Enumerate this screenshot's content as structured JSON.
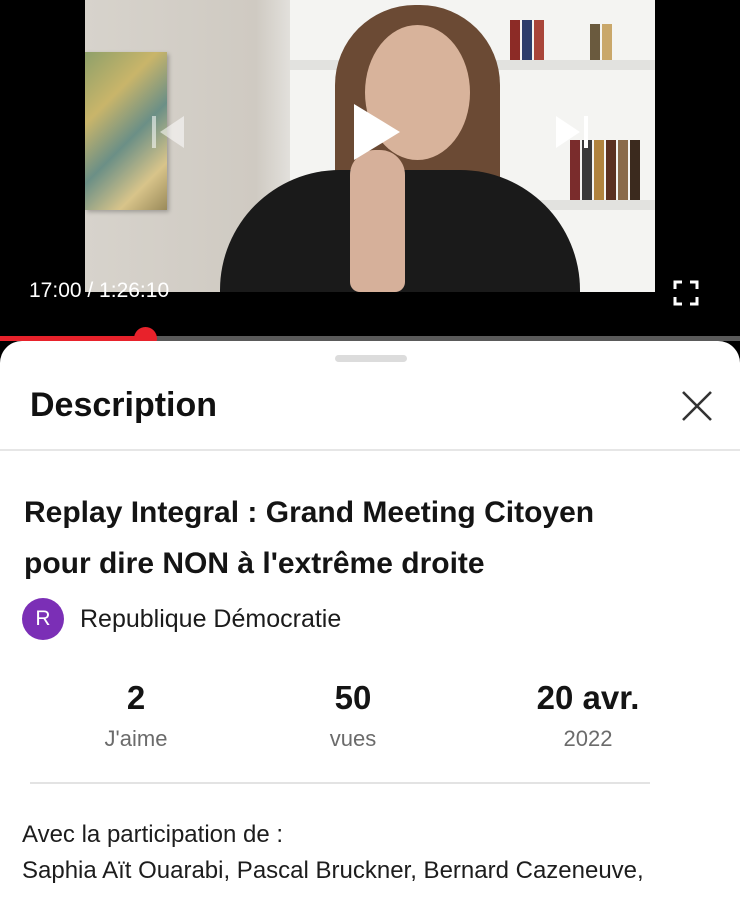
{
  "player": {
    "time": "17:00 / 1:26:10",
    "progress_fraction": 0.196,
    "accent_color": "#e8222b"
  },
  "icons": {
    "previous": "skip-previous-icon",
    "play": "play-icon",
    "next": "skip-next-icon",
    "fullscreen": "fullscreen-icon",
    "close": "close-icon"
  },
  "sheet": {
    "title": "Description",
    "video_title_line1": "Replay Integral : Grand Meeting Citoyen",
    "video_title_line2": "pour dire NON à l'extrême droite",
    "channel": {
      "avatar_letter": "R",
      "name": "Republique Démocratie",
      "avatar_color": "#7b2fb6"
    },
    "stats": [
      {
        "value": "2",
        "label": "J'aime"
      },
      {
        "value": "50",
        "label": "vues"
      },
      {
        "value": "20 avr.",
        "label": "2022"
      }
    ],
    "description_lines": [
      "Avec la participation de :",
      "Saphia Aït Ouarabi, Pascal Bruckner, Bernard Cazeneuve,"
    ]
  }
}
